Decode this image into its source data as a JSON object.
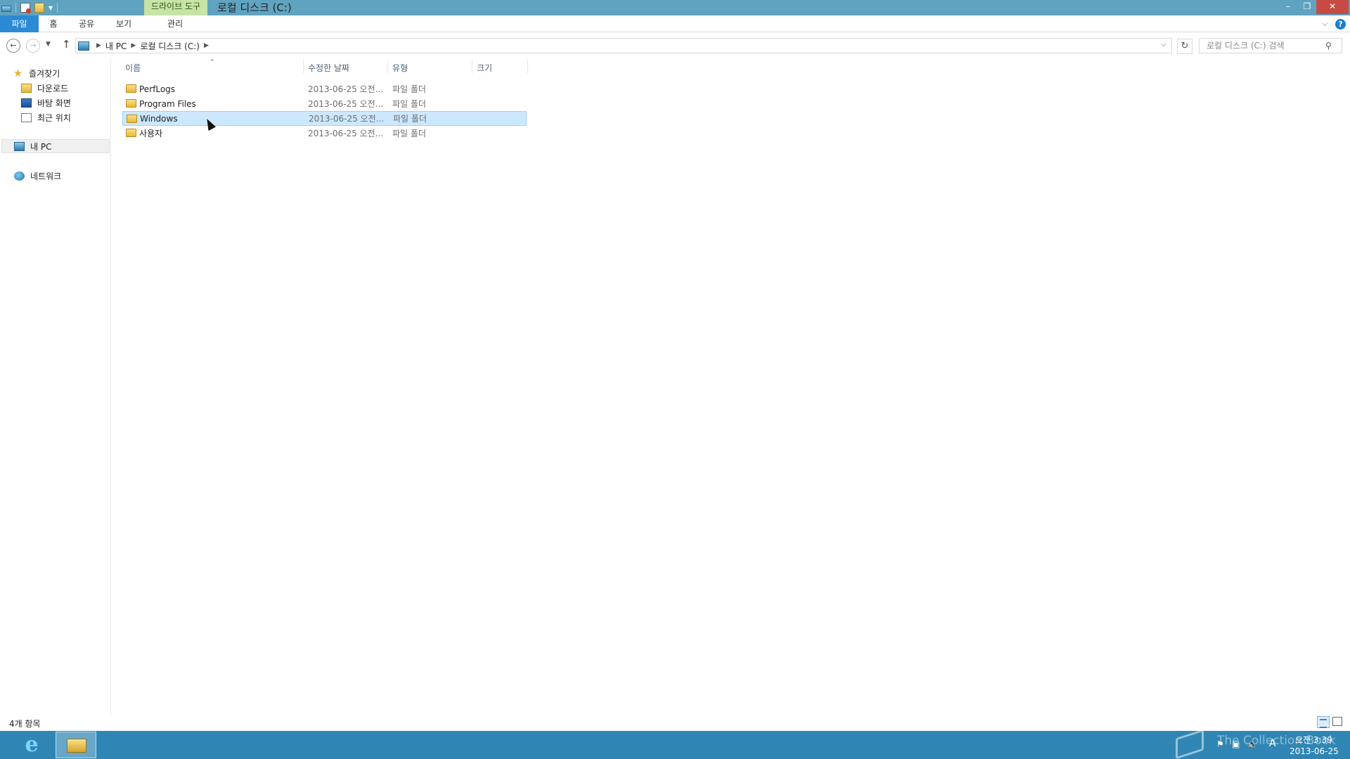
{
  "window": {
    "title": "로컬 디스크 (C:)",
    "context_tab": "드라이브 도구",
    "minimize_glyph": "–",
    "maximize_glyph": "❐",
    "close_glyph": "✕"
  },
  "ribbon": {
    "tabs": [
      "파일",
      "홈",
      "공유",
      "보기",
      "관리"
    ],
    "active_tab": "파일",
    "accent_color": "#2a8ad4"
  },
  "address": {
    "crumbs": [
      "내 PC",
      "로컬 디스크 (C:)"
    ],
    "search_placeholder": "로컬 디스크 (C:) 검색"
  },
  "navpane": {
    "favorites_label": "즐겨찾기",
    "favorites": [
      "다운로드",
      "바탕 화면",
      "최근 위치"
    ],
    "pc_label": "내 PC",
    "network_label": "네트워크"
  },
  "columns": [
    "이름",
    "수정한 날짜",
    "유형",
    "크기"
  ],
  "files": [
    {
      "name": "PerfLogs",
      "date": "2013-06-25 오전...",
      "type": "파일 폴더",
      "selected": false
    },
    {
      "name": "Program Files",
      "date": "2013-06-25 오전...",
      "type": "파일 폴더",
      "selected": false
    },
    {
      "name": "Windows",
      "date": "2013-06-25 오전...",
      "type": "파일 폴더",
      "selected": true
    },
    {
      "name": "사용자",
      "date": "2013-06-25 오전...",
      "type": "파일 폴더",
      "selected": false
    }
  ],
  "status": {
    "item_count": "4개 항목"
  },
  "taskbar": {
    "watermark": "The Collection Book",
    "time": "오전 3:39",
    "date": "2013-06-25",
    "ime": "A",
    "color": "#2f86b4"
  }
}
